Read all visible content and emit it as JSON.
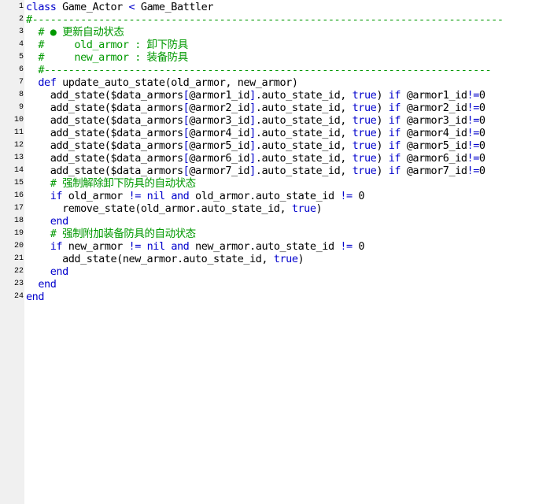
{
  "colors": {
    "keyword": "#0000cc",
    "operator": "#0000cc",
    "comment": "#009900",
    "text": "#000000",
    "gutter_bg": "#f0f0f0",
    "editor_bg": "#ffffff"
  },
  "lines": [
    {
      "num": "1",
      "tokens": [
        {
          "t": "kw",
          "v": "class"
        },
        {
          "t": "txt",
          "v": " Game_Actor "
        },
        {
          "t": "op",
          "v": "<"
        },
        {
          "t": "txt",
          "v": " Game_Battler"
        }
      ]
    },
    {
      "num": "2",
      "tokens": [
        {
          "t": "cm",
          "v": "#------------------------------------------------------------------------------"
        }
      ]
    },
    {
      "num": "3",
      "tokens": [
        {
          "t": "txt",
          "v": "  "
        },
        {
          "t": "cm",
          "v": "# ● 更新自动状态"
        }
      ]
    },
    {
      "num": "4",
      "tokens": [
        {
          "t": "txt",
          "v": "  "
        },
        {
          "t": "cm",
          "v": "#     old_armor : 卸下防具"
        }
      ]
    },
    {
      "num": "5",
      "tokens": [
        {
          "t": "txt",
          "v": "  "
        },
        {
          "t": "cm",
          "v": "#     new_armor : 装备防具"
        }
      ]
    },
    {
      "num": "6",
      "tokens": [
        {
          "t": "txt",
          "v": "  "
        },
        {
          "t": "cm",
          "v": "#--------------------------------------------------------------------------"
        }
      ]
    },
    {
      "num": "7",
      "tokens": [
        {
          "t": "txt",
          "v": "  "
        },
        {
          "t": "kw",
          "v": "def"
        },
        {
          "t": "txt",
          "v": " update_auto_state(old_armor, new_armor)"
        }
      ]
    },
    {
      "num": "8",
      "tokens": [
        {
          "t": "txt",
          "v": "    add_state($data_armors"
        },
        {
          "t": "op",
          "v": "["
        },
        {
          "t": "txt",
          "v": "@armor1_id"
        },
        {
          "t": "op",
          "v": "]"
        },
        {
          "t": "txt",
          "v": ".auto_state_id, "
        },
        {
          "t": "kw",
          "v": "true"
        },
        {
          "t": "txt",
          "v": ") "
        },
        {
          "t": "kw",
          "v": "if"
        },
        {
          "t": "txt",
          "v": " @armor1_id"
        },
        {
          "t": "op",
          "v": "!="
        },
        {
          "t": "txt",
          "v": "0"
        }
      ]
    },
    {
      "num": "9",
      "tokens": [
        {
          "t": "txt",
          "v": "    add_state($data_armors"
        },
        {
          "t": "op",
          "v": "["
        },
        {
          "t": "txt",
          "v": "@armor2_id"
        },
        {
          "t": "op",
          "v": "]"
        },
        {
          "t": "txt",
          "v": ".auto_state_id, "
        },
        {
          "t": "kw",
          "v": "true"
        },
        {
          "t": "txt",
          "v": ") "
        },
        {
          "t": "kw",
          "v": "if"
        },
        {
          "t": "txt",
          "v": " @armor2_id"
        },
        {
          "t": "op",
          "v": "!="
        },
        {
          "t": "txt",
          "v": "0"
        }
      ]
    },
    {
      "num": "10",
      "tokens": [
        {
          "t": "txt",
          "v": "    add_state($data_armors"
        },
        {
          "t": "op",
          "v": "["
        },
        {
          "t": "txt",
          "v": "@armor3_id"
        },
        {
          "t": "op",
          "v": "]"
        },
        {
          "t": "txt",
          "v": ".auto_state_id, "
        },
        {
          "t": "kw",
          "v": "true"
        },
        {
          "t": "txt",
          "v": ") "
        },
        {
          "t": "kw",
          "v": "if"
        },
        {
          "t": "txt",
          "v": " @armor3_id"
        },
        {
          "t": "op",
          "v": "!="
        },
        {
          "t": "txt",
          "v": "0"
        }
      ]
    },
    {
      "num": "11",
      "tokens": [
        {
          "t": "txt",
          "v": "    add_state($data_armors"
        },
        {
          "t": "op",
          "v": "["
        },
        {
          "t": "txt",
          "v": "@armor4_id"
        },
        {
          "t": "op",
          "v": "]"
        },
        {
          "t": "txt",
          "v": ".auto_state_id, "
        },
        {
          "t": "kw",
          "v": "true"
        },
        {
          "t": "txt",
          "v": ") "
        },
        {
          "t": "kw",
          "v": "if"
        },
        {
          "t": "txt",
          "v": " @armor4_id"
        },
        {
          "t": "op",
          "v": "!="
        },
        {
          "t": "txt",
          "v": "0"
        }
      ]
    },
    {
      "num": "12",
      "tokens": [
        {
          "t": "txt",
          "v": "    add_state($data_armors"
        },
        {
          "t": "op",
          "v": "["
        },
        {
          "t": "txt",
          "v": "@armor5_id"
        },
        {
          "t": "op",
          "v": "]"
        },
        {
          "t": "txt",
          "v": ".auto_state_id, "
        },
        {
          "t": "kw",
          "v": "true"
        },
        {
          "t": "txt",
          "v": ") "
        },
        {
          "t": "kw",
          "v": "if"
        },
        {
          "t": "txt",
          "v": " @armor5_id"
        },
        {
          "t": "op",
          "v": "!="
        },
        {
          "t": "txt",
          "v": "0"
        }
      ]
    },
    {
      "num": "13",
      "tokens": [
        {
          "t": "txt",
          "v": "    add_state($data_armors"
        },
        {
          "t": "op",
          "v": "["
        },
        {
          "t": "txt",
          "v": "@armor6_id"
        },
        {
          "t": "op",
          "v": "]"
        },
        {
          "t": "txt",
          "v": ".auto_state_id, "
        },
        {
          "t": "kw",
          "v": "true"
        },
        {
          "t": "txt",
          "v": ") "
        },
        {
          "t": "kw",
          "v": "if"
        },
        {
          "t": "txt",
          "v": " @armor6_id"
        },
        {
          "t": "op",
          "v": "!="
        },
        {
          "t": "txt",
          "v": "0"
        }
      ]
    },
    {
      "num": "14",
      "tokens": [
        {
          "t": "txt",
          "v": "    add_state($data_armors"
        },
        {
          "t": "op",
          "v": "["
        },
        {
          "t": "txt",
          "v": "@armor7_id"
        },
        {
          "t": "op",
          "v": "]"
        },
        {
          "t": "txt",
          "v": ".auto_state_id, "
        },
        {
          "t": "kw",
          "v": "true"
        },
        {
          "t": "txt",
          "v": ") "
        },
        {
          "t": "kw",
          "v": "if"
        },
        {
          "t": "txt",
          "v": " @armor7_id"
        },
        {
          "t": "op",
          "v": "!="
        },
        {
          "t": "txt",
          "v": "0"
        }
      ]
    },
    {
      "num": "15",
      "tokens": [
        {
          "t": "txt",
          "v": "    "
        },
        {
          "t": "cm",
          "v": "# 强制解除卸下防具的自动状态"
        }
      ]
    },
    {
      "num": "16",
      "tokens": [
        {
          "t": "txt",
          "v": "    "
        },
        {
          "t": "kw",
          "v": "if"
        },
        {
          "t": "txt",
          "v": " old_armor "
        },
        {
          "t": "op",
          "v": "!="
        },
        {
          "t": "txt",
          "v": " "
        },
        {
          "t": "kw",
          "v": "nil"
        },
        {
          "t": "txt",
          "v": " "
        },
        {
          "t": "kw",
          "v": "and"
        },
        {
          "t": "txt",
          "v": " old_armor.auto_state_id "
        },
        {
          "t": "op",
          "v": "!="
        },
        {
          "t": "txt",
          "v": " 0"
        }
      ]
    },
    {
      "num": "17",
      "tokens": [
        {
          "t": "txt",
          "v": "      remove_state(old_armor.auto_state_id, "
        },
        {
          "t": "kw",
          "v": "true"
        },
        {
          "t": "txt",
          "v": ")"
        }
      ]
    },
    {
      "num": "18",
      "tokens": [
        {
          "t": "txt",
          "v": "    "
        },
        {
          "t": "kw",
          "v": "end"
        }
      ]
    },
    {
      "num": "19",
      "tokens": [
        {
          "t": "txt",
          "v": "    "
        },
        {
          "t": "cm",
          "v": "# 强制附加装备防具的自动状态"
        }
      ]
    },
    {
      "num": "20",
      "tokens": [
        {
          "t": "txt",
          "v": "    "
        },
        {
          "t": "kw",
          "v": "if"
        },
        {
          "t": "txt",
          "v": " new_armor "
        },
        {
          "t": "op",
          "v": "!="
        },
        {
          "t": "txt",
          "v": " "
        },
        {
          "t": "kw",
          "v": "nil"
        },
        {
          "t": "txt",
          "v": " "
        },
        {
          "t": "kw",
          "v": "and"
        },
        {
          "t": "txt",
          "v": " new_armor.auto_state_id "
        },
        {
          "t": "op",
          "v": "!="
        },
        {
          "t": "txt",
          "v": " 0"
        }
      ]
    },
    {
      "num": "21",
      "tokens": [
        {
          "t": "txt",
          "v": "      add_state(new_armor.auto_state_id, "
        },
        {
          "t": "kw",
          "v": "true"
        },
        {
          "t": "txt",
          "v": ")"
        }
      ]
    },
    {
      "num": "22",
      "tokens": [
        {
          "t": "txt",
          "v": "    "
        },
        {
          "t": "kw",
          "v": "end"
        }
      ]
    },
    {
      "num": "23",
      "tokens": [
        {
          "t": "txt",
          "v": "  "
        },
        {
          "t": "kw",
          "v": "end"
        }
      ]
    },
    {
      "num": "24",
      "tokens": [
        {
          "t": "kw",
          "v": "end"
        }
      ]
    }
  ]
}
